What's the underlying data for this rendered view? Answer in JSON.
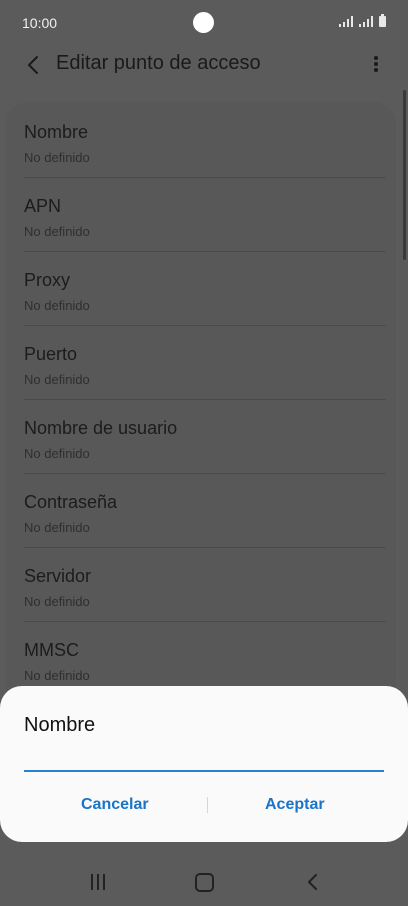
{
  "status_bar": {
    "time": "10:00",
    "icons": [
      "camera-cutout",
      "signal-icon",
      "signal-icon",
      "battery-icon"
    ]
  },
  "app_bar": {
    "back_icon": "chevron-left-icon",
    "title": "Editar punto de acceso",
    "more_icon": "more-vertical-icon"
  },
  "settings": {
    "items": [
      {
        "label": "Nombre",
        "value": "No definido"
      },
      {
        "label": "APN",
        "value": "No definido"
      },
      {
        "label": "Proxy",
        "value": "No definido"
      },
      {
        "label": "Puerto",
        "value": "No definido"
      },
      {
        "label": "Nombre de usuario",
        "value": "No definido"
      },
      {
        "label": "Contraseña",
        "value": "No definido"
      },
      {
        "label": "Servidor",
        "value": "No definido"
      },
      {
        "label": "MMSC",
        "value": "No definido"
      }
    ]
  },
  "dialog": {
    "title": "Nombre",
    "input_value": "",
    "cancel_label": "Cancelar",
    "accept_label": "Aceptar",
    "accent_color": "#1a74c7"
  },
  "nav_bar": {
    "icons": [
      "recents-icon",
      "home-icon",
      "back-icon"
    ]
  }
}
